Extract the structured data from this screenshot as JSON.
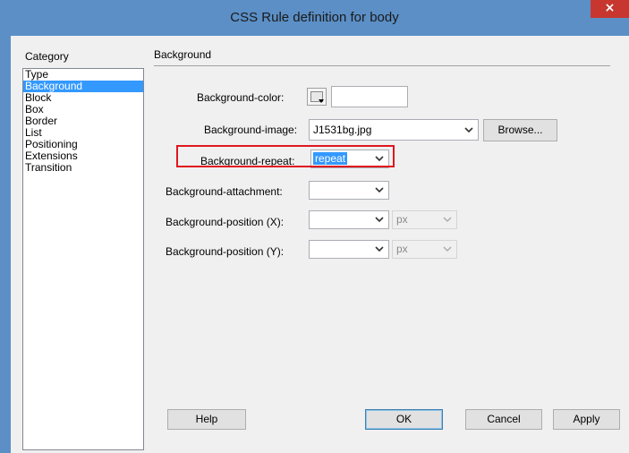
{
  "window": {
    "title": "CSS Rule definition for body",
    "close_glyph": "×"
  },
  "category": {
    "label": "Category",
    "items": [
      "Type",
      "Background",
      "Block",
      "Box",
      "Border",
      "List",
      "Positioning",
      "Extensions",
      "Transition"
    ],
    "selected": "Background"
  },
  "panel": {
    "title": "Background",
    "background_color": {
      "label": "Background-color:",
      "value": ""
    },
    "background_image": {
      "label": "Background-image:",
      "value": "J1531bg.jpg",
      "browse": "Browse..."
    },
    "background_repeat": {
      "label": "Background-repeat:",
      "value": "repeat"
    },
    "background_attachment": {
      "label": "Background-attachment:",
      "value": ""
    },
    "background_position_x": {
      "label": "Background-position (X):",
      "value": "",
      "unit": "px"
    },
    "background_position_y": {
      "label": "Background-position (Y):",
      "value": "",
      "unit": "px"
    }
  },
  "buttons": {
    "help": "Help",
    "ok": "OK",
    "cancel": "Cancel",
    "apply": "Apply"
  },
  "colors": {
    "title_bar": "#5b8fc6",
    "close_button": "#c7372f",
    "selection": "#3399ff",
    "highlight_box": "#e0161e"
  }
}
